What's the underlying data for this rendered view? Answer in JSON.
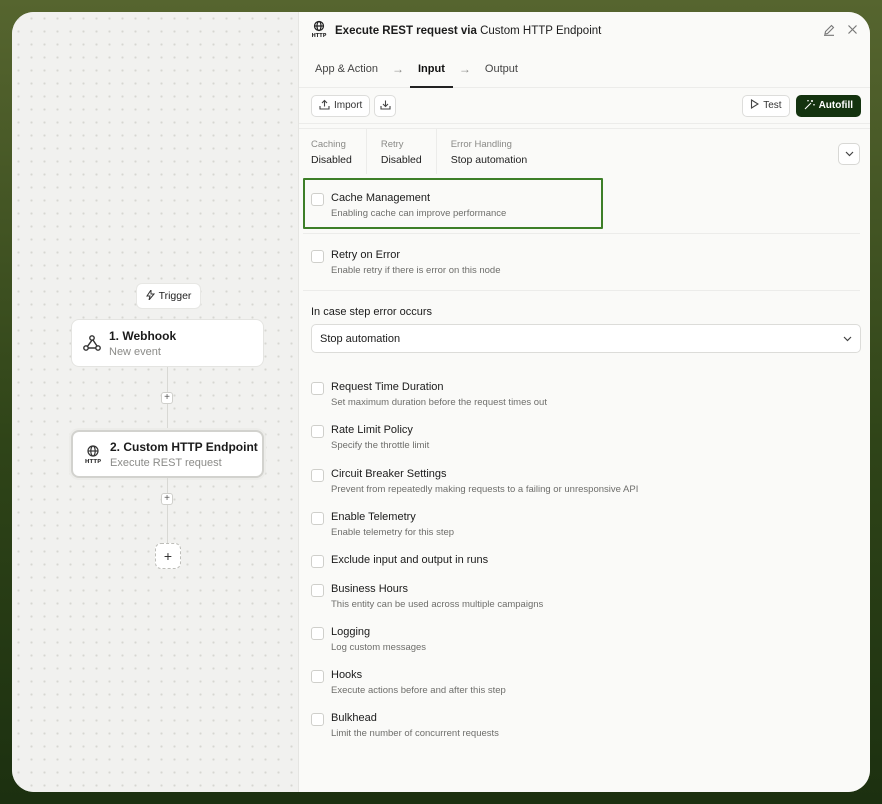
{
  "canvas": {
    "trigger_label": "Trigger",
    "nodes": [
      {
        "title": "1. Webhook",
        "subtitle": "New event"
      },
      {
        "title": "2. Custom HTTP Endpoint",
        "subtitle": "Execute REST request"
      }
    ],
    "add_symbol": "+"
  },
  "panel": {
    "title_bold": "Execute REST request via",
    "title_rest": "Custom HTTP Endpoint",
    "tabs": [
      "App & Action",
      "Input",
      "Output"
    ],
    "active_tab": "Input",
    "toolbar": {
      "import_label": "Import",
      "test_label": "Test",
      "autofill_label": "Autofill"
    },
    "summary": [
      {
        "label": "Caching",
        "value": "Disabled"
      },
      {
        "label": "Retry",
        "value": "Disabled"
      },
      {
        "label": "Error Handling",
        "value": "Stop automation"
      }
    ],
    "cache": {
      "title": "Cache Management",
      "desc": "Enabling cache can improve performance"
    },
    "retry": {
      "title": "Retry on Error",
      "desc": "Enable retry if there is error on this node"
    },
    "error_label": "In case step error occurs",
    "error_select": "Stop automation",
    "options": [
      {
        "title": "Request Time Duration",
        "desc": "Set maximum duration before the request times out"
      },
      {
        "title": "Rate Limit Policy",
        "desc": "Specify the throttle limit"
      },
      {
        "title": "Circuit Breaker Settings",
        "desc": "Prevent from repeatedly making requests to a failing or unresponsive API"
      },
      {
        "title": "Enable Telemetry",
        "desc": "Enable telemetry for this step"
      },
      {
        "title": "Exclude input and output in runs",
        "desc": ""
      },
      {
        "title": "Business Hours",
        "desc": "This entity can be used across multiple campaigns"
      },
      {
        "title": "Logging",
        "desc": "Log custom messages"
      },
      {
        "title": "Hooks",
        "desc": "Execute actions before and after this step"
      },
      {
        "title": "Bulkhead",
        "desc": "Limit the number of concurrent requests"
      }
    ]
  },
  "colors": {
    "accent": "#14330f",
    "highlight": "#3d7f28"
  }
}
